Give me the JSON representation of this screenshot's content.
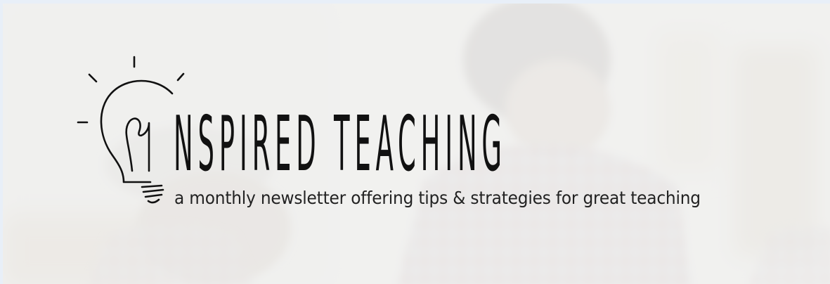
{
  "banner": {
    "title": "NSPIRED TEACHING",
    "subtitle": "a monthly newsletter offering tips & strategies for great teaching"
  },
  "colors": {
    "ink": "#111111",
    "subtitle_ink": "#222222",
    "page_border": "#e8eff8",
    "photo_tint": "#f1f1f0"
  },
  "icons": {
    "logo": "lightbulb-icon"
  }
}
